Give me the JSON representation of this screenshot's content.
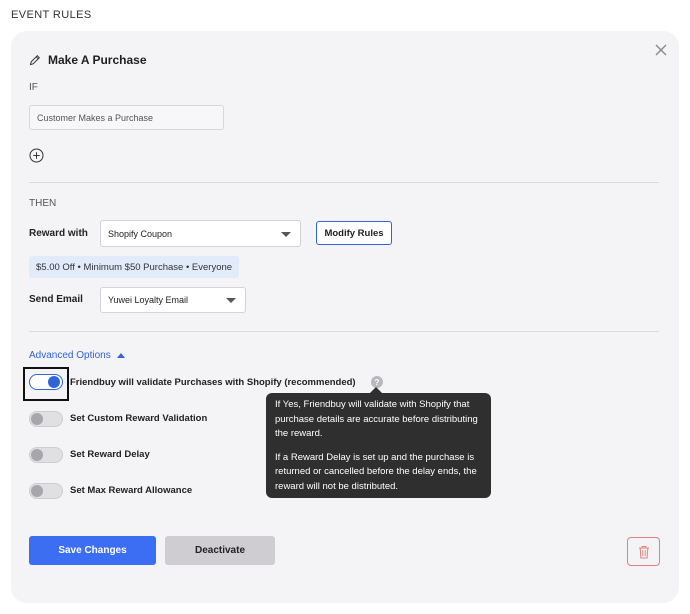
{
  "section": {
    "title": "EVENT RULES"
  },
  "rule": {
    "title": "Make A Purchase",
    "if_label": "IF",
    "condition_value": "Customer Makes a Purchase",
    "then_label": "THEN",
    "reward_label": "Reward with",
    "reward_type": "Shopify Coupon",
    "modify_button": "Modify Rules",
    "reward_summary": "$5.00 Off • Minimum $50 Purchase • Everyone",
    "email_label": "Send Email",
    "email_value": "Yuwei Loyalty Email"
  },
  "advanced": {
    "toggle_label": "Advanced Options",
    "options": [
      {
        "label": "Friendbuy will validate Purchases with Shopify (recommended)",
        "enabled": true
      },
      {
        "label": "Set Custom Reward Validation",
        "enabled": false
      },
      {
        "label": "Set Reward Delay",
        "enabled": false
      },
      {
        "label": "Set Max Reward Allowance",
        "enabled": false
      }
    ],
    "help_glyph": "?"
  },
  "tooltip": {
    "para1": "If Yes, Friendbuy will validate with Shopify that purchase details are accurate before distributing the reward.",
    "para2": "If a Reward Delay is set up and the purchase is returned or cancelled before the delay ends, the reward will not be distributed."
  },
  "actions": {
    "save_label": "Save Changes",
    "deactivate_label": "Deactivate"
  },
  "colors": {
    "accent": "#3b6ef2",
    "card_bg": "#f4f3f5",
    "tooltip_bg": "#2f2f30",
    "delete": "#e0837c"
  },
  "icons": [
    "close-icon",
    "pencil-icon",
    "plus-circle-icon",
    "chevron-down-icon",
    "chevron-up-icon",
    "question-icon",
    "trash-icon"
  ]
}
